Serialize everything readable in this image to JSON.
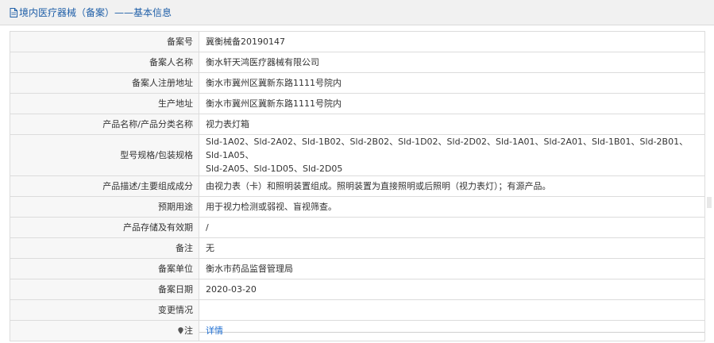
{
  "header": {
    "title": "境内医疗器械（备案）——基本信息",
    "icon": "document-icon",
    "title_color": "#1f5fa8"
  },
  "rows": [
    {
      "label": "备案号",
      "value": "冀衡械备20190147"
    },
    {
      "label": "备案人名称",
      "value": "衡水轩天鸿医疗器械有限公司"
    },
    {
      "label": "备案人注册地址",
      "value": "衡水市冀州区冀新东路1111号院内"
    },
    {
      "label": "生产地址",
      "value": "衡水市冀州区冀新东路1111号院内"
    },
    {
      "label": "产品名称/产品分类名称",
      "value": "视力表灯箱"
    },
    {
      "label": "型号规格/包装规格",
      "value_line1": "Sld-1A02、Sld-2A02、Sld-1B02、Sld-2B02、Sld-1D02、Sld-2D02、Sld-1A01、Sld-2A01、Sld-1B01、Sld-2B01、Sld-1A05、",
      "value_line2": "Sld-2A05、Sld-1D05、Sld-2D05"
    },
    {
      "label": "产品描述/主要组成成分",
      "value": "由视力表（卡）和照明装置组成。照明装置为直接照明或后照明（视力表灯）；有源产品。"
    },
    {
      "label": "预期用途",
      "value": "用于视力检测或弱视、盲视筛查。"
    },
    {
      "label": "产品存储及有效期",
      "value": "/"
    },
    {
      "label": "备注",
      "value": "无"
    },
    {
      "label": "备案单位",
      "value": "衡水市药品监督管理局"
    },
    {
      "label": "备案日期",
      "value": "2020-03-20"
    },
    {
      "label": "变更情况",
      "value": ""
    },
    {
      "label": "注",
      "value": "详情",
      "icon": "location-pin-icon"
    }
  ],
  "colors": {
    "link": "#1f6fd2",
    "label_bg": "#f7f7f7",
    "border": "#dcdcdc"
  }
}
